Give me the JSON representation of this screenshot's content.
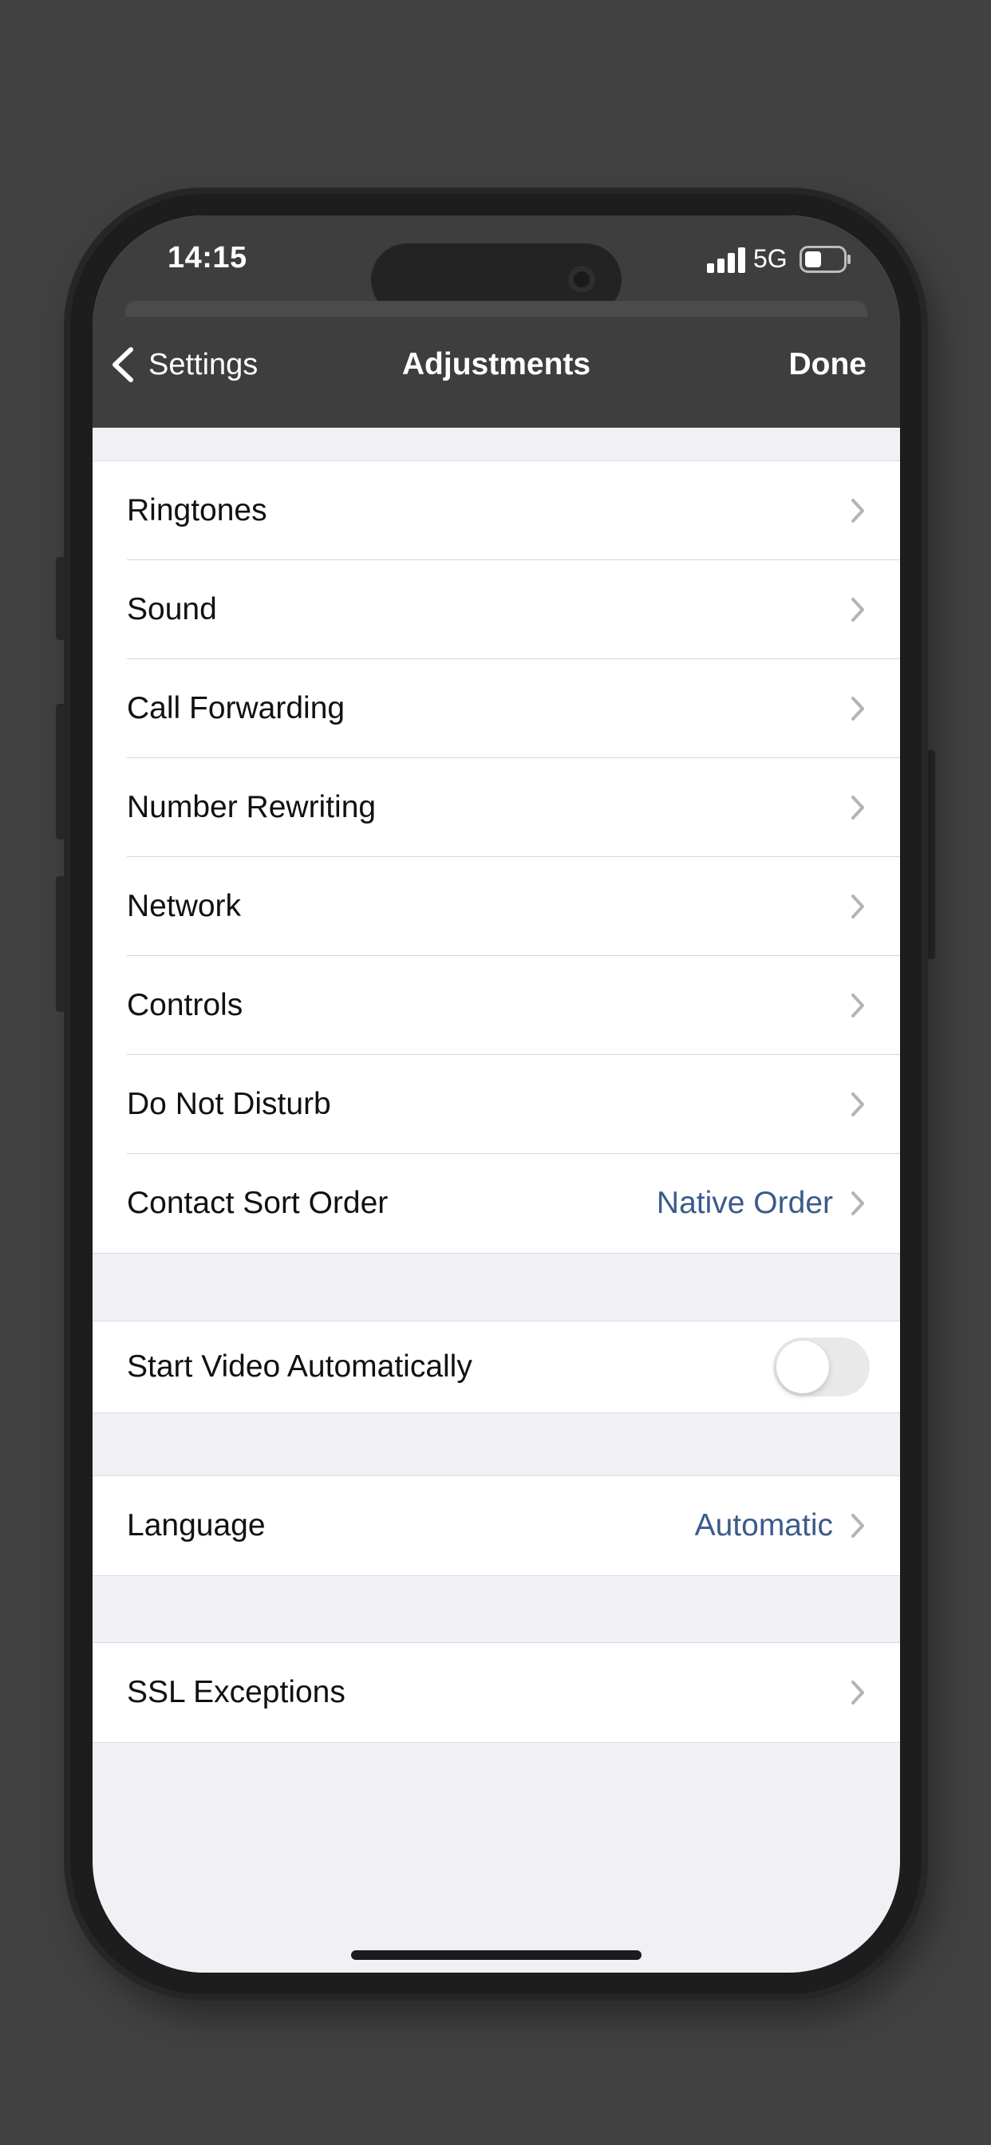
{
  "status_bar": {
    "time": "14:15",
    "network": "5G"
  },
  "nav": {
    "back_label": "Settings",
    "title": "Adjustments",
    "done_label": "Done"
  },
  "groups": {
    "main": [
      {
        "label": "Ringtones",
        "value": ""
      },
      {
        "label": "Sound",
        "value": ""
      },
      {
        "label": "Call Forwarding",
        "value": ""
      },
      {
        "label": "Number Rewriting",
        "value": ""
      },
      {
        "label": "Network",
        "value": ""
      },
      {
        "label": "Controls",
        "value": ""
      },
      {
        "label": "Do Not Disturb",
        "value": ""
      },
      {
        "label": "Contact Sort Order",
        "value": "Native Order"
      }
    ],
    "video": {
      "label": "Start Video Automatically",
      "enabled": false
    },
    "language": {
      "label": "Language",
      "value": "Automatic"
    },
    "ssl": {
      "label": "SSL Exceptions"
    }
  },
  "colors": {
    "accent_value": "#3b5b8c",
    "header_bg": "#3e3e3e",
    "list_bg": "#f0f0f5"
  }
}
